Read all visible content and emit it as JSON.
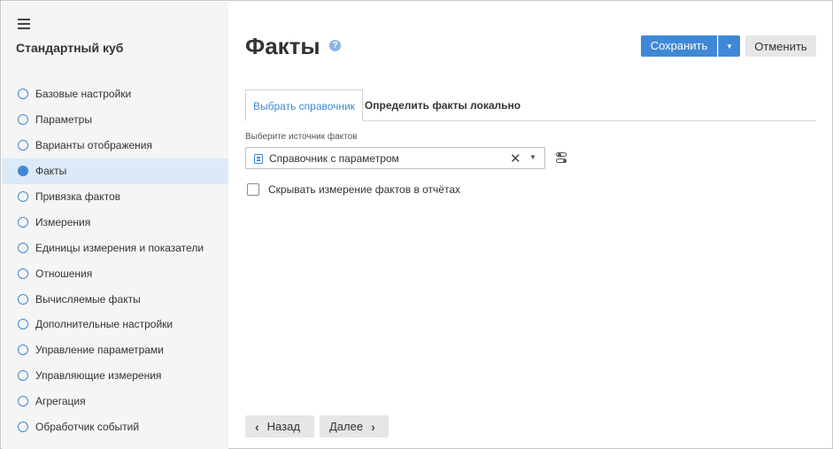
{
  "sidebar": {
    "title": "Стандартный куб",
    "items": [
      {
        "label": "Базовые настройки",
        "active": false
      },
      {
        "label": "Параметры",
        "active": false
      },
      {
        "label": "Варианты отображения",
        "active": false
      },
      {
        "label": "Факты",
        "active": true
      },
      {
        "label": "Привязка фактов",
        "active": false
      },
      {
        "label": "Измерения",
        "active": false
      },
      {
        "label": "Единицы измерения и показатели",
        "active": false
      },
      {
        "label": "Отношения",
        "active": false
      },
      {
        "label": "Вычисляемые факты",
        "active": false
      },
      {
        "label": "Дополнительные настройки",
        "active": false
      },
      {
        "label": "Управление параметрами",
        "active": false
      },
      {
        "label": "Управляющие измерения",
        "active": false
      },
      {
        "label": "Агрегация",
        "active": false
      },
      {
        "label": "Обработчик событий",
        "active": false
      }
    ]
  },
  "header": {
    "title": "Факты",
    "help": "?",
    "save_label": "Сохранить",
    "cancel_label": "Отменить"
  },
  "tabs": [
    {
      "label": "Выбрать справочник",
      "active": true
    },
    {
      "label": "Определить факты локально",
      "active": false
    }
  ],
  "source": {
    "label": "Выберите источник фактов",
    "value": "Справочник с параметром"
  },
  "hide_dimension": {
    "label": "Скрывать измерение фактов в отчётах",
    "checked": false
  },
  "footer": {
    "back_label": "Назад",
    "next_label": "Далее"
  },
  "colors": {
    "accent": "#3f88d6",
    "sidebar_bg": "#f5f5f5",
    "active_item_bg": "#dceaf8"
  }
}
